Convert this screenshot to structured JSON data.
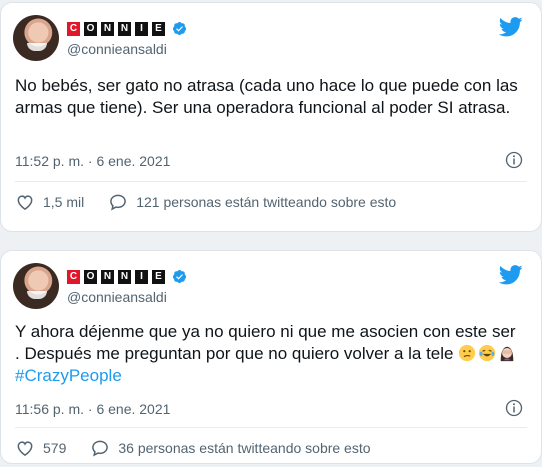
{
  "tweets": [
    {
      "brand_letters": [
        "C",
        "O",
        "N",
        "N",
        "I",
        "E"
      ],
      "handle": "@connieansaldi",
      "text": "No bebés, ser gato no atrasa (cada uno hace lo que puede con las armas que tiene). Ser una operadora funcional al poder SI atrasa.",
      "hashtag": "",
      "timestamp": "11:52 p. m. · 6 ene. 2021",
      "likes": "1,5 mil",
      "replies_label": "121 personas están twitteando sobre esto"
    },
    {
      "brand_letters": [
        "C",
        "O",
        "N",
        "N",
        "I",
        "E"
      ],
      "handle": "@connieansaldi",
      "text": "Y ahora déjenme que ya no quiero ni que me asocien con este ser . Después me preguntan por que no quiero volver a la tele",
      "emojis": [
        "confused-face",
        "laughing-tears-face",
        "facepalm-woman"
      ],
      "hashtag": "#CrazyPeople",
      "timestamp": "11:56 p. m. · 6 ene. 2021",
      "likes": "579",
      "replies_label": "36 personas están twitteando sobre esto"
    }
  ],
  "colors": {
    "brand_red": "#e0172b",
    "twitter_blue": "#1d9bf0",
    "secondary_text": "#536471"
  }
}
